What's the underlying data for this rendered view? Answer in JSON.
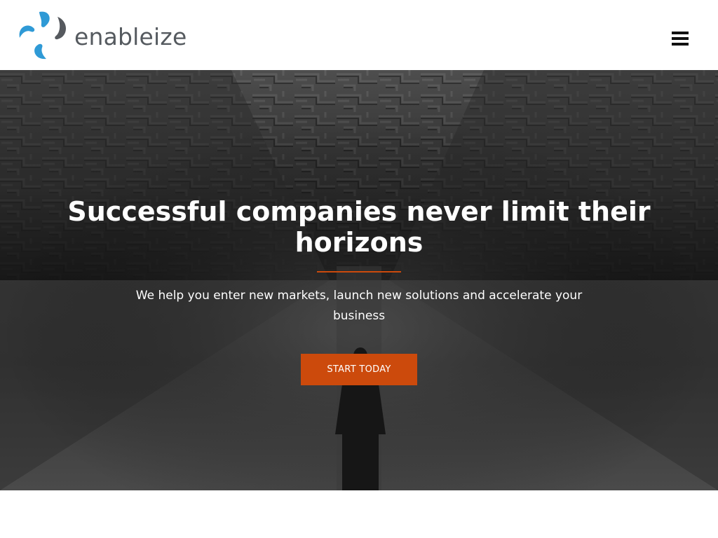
{
  "header": {
    "logo_text": "enableize",
    "logo_icon": "enableize-swirl-logo",
    "menu_icon": "hamburger-menu-icon"
  },
  "hero": {
    "title": "Successful companies never limit their horizons",
    "subtitle": "We help you enter new markets, launch new solutions and accelerate your business",
    "cta_label": "START TODAY",
    "background": "maze-with-person-photo"
  },
  "colors": {
    "accent": "#cc4a0c",
    "logo_blue": "#2f9ad6",
    "logo_text": "#555a5f",
    "hero_text": "#ffffff"
  }
}
